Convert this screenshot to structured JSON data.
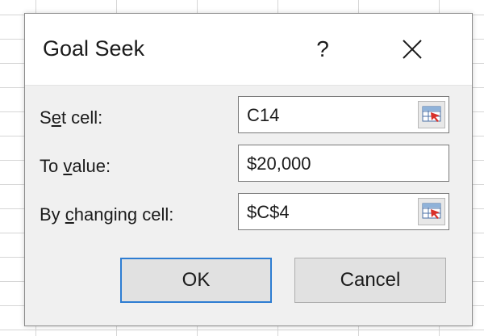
{
  "dialog": {
    "title": "Goal Seek",
    "help_glyph": "?",
    "close_icon": "close-icon"
  },
  "fields": {
    "set_cell": {
      "label_pre": "S",
      "label_accel": "e",
      "label_post": "t cell:",
      "value": "C14"
    },
    "to_value": {
      "label_pre": "To ",
      "label_accel": "v",
      "label_post": "alue:",
      "value": "$20,000"
    },
    "by_changing_cell": {
      "label_pre": "By ",
      "label_accel": "c",
      "label_post": "hanging cell:",
      "value": "$C$4"
    }
  },
  "buttons": {
    "ok_label": "OK",
    "cancel_label": "Cancel"
  },
  "colors": {
    "default_button_border": "#2e7dd2",
    "range_icon_red": "#d9302a"
  }
}
